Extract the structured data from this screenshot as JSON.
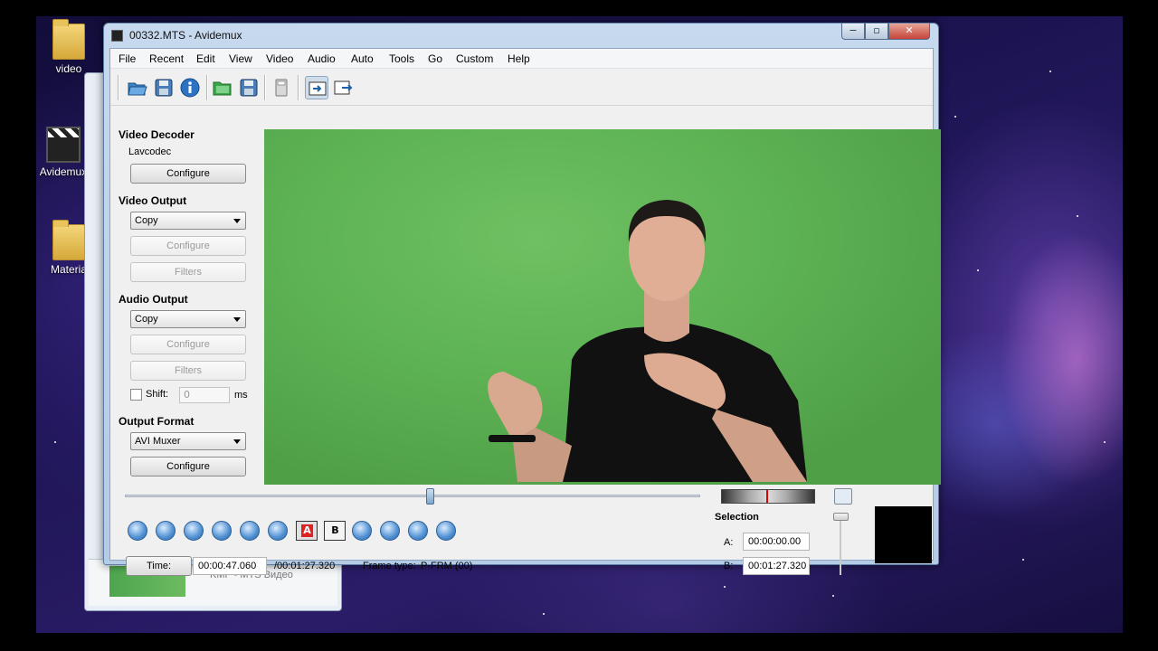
{
  "desktop": {
    "icons": [
      "video",
      "Avidemux",
      "Materia"
    ],
    "background_window": {
      "item_label": "KMP - MTS Видео"
    }
  },
  "window": {
    "title": "00332.MTS - Avidemux",
    "caption_buttons": {
      "minimize": "−",
      "maximize": "▫",
      "close": "✕"
    }
  },
  "menu": [
    "File",
    "Recent",
    "Edit",
    "View",
    "Video",
    "Audio",
    "Auto",
    "Tools",
    "Go",
    "Custom",
    "Help"
  ],
  "toolbar": {
    "buttons": [
      "open-icon",
      "save-icon",
      "info-icon",
      "open-folder-icon",
      "save-video-icon",
      "calculator-icon",
      "display-input-icon",
      "display-output-icon"
    ]
  },
  "left_panel": {
    "video_decoder": {
      "title": "Video Decoder",
      "codec": "Lavcodec",
      "configure": "Configure"
    },
    "video_output": {
      "title": "Video Output",
      "selected": "Copy",
      "configure": "Configure",
      "filters": "Filters"
    },
    "audio_output": {
      "title": "Audio Output",
      "selected": "Copy",
      "configure": "Configure",
      "filters": "Filters",
      "shift_label": "Shift:",
      "shift_value": "0",
      "shift_unit": "ms"
    },
    "output_format": {
      "title": "Output Format",
      "selected": "AVI Muxer",
      "configure": "Configure"
    }
  },
  "playback": {
    "position_fraction": 0.53,
    "marker_a": "A",
    "marker_b": "B"
  },
  "status": {
    "time_button": "Time:",
    "current_time": "00:00:47.060",
    "total_time": "/00:01:27.320",
    "frame_type_label": "Frame type:",
    "frame_type": "P-FRM (00)"
  },
  "selection": {
    "title": "Selection",
    "a_label": "A:",
    "a_value": "00:00:00.00",
    "b_label": "B:",
    "b_value": "00:01:27.320"
  }
}
